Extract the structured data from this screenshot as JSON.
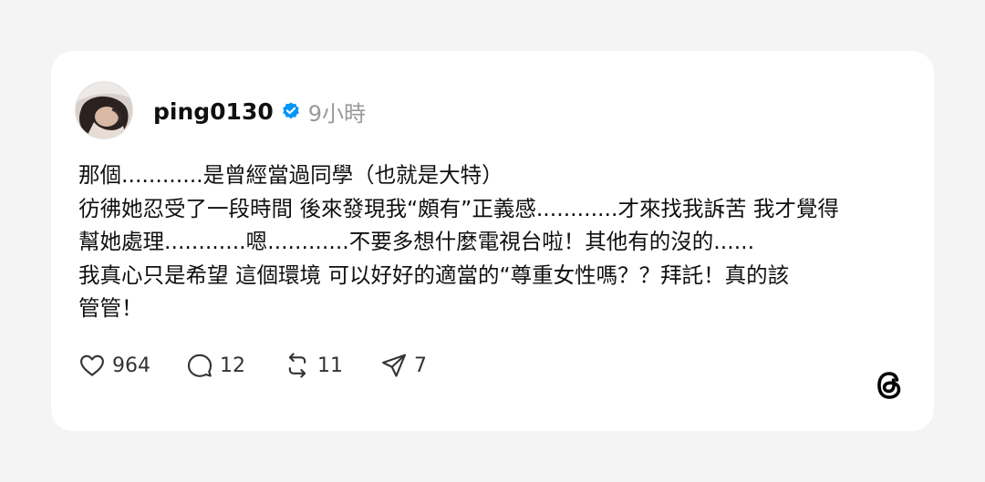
{
  "post": {
    "username": "ping0130",
    "verified": true,
    "time": "9小時",
    "lines": [
      "那個............是曾經當過同學（也就是大特）",
      "彷彿她忍受了一段時間 後來發現我“頗有”正義感............才來找我訴苦 我才覺得",
      "幫她處理............嗯............不要多想什麼電視台啦！其他有的沒的......",
      "我真心只是希望 這個環境 可以好好的適當的“尊重女性嗎？？拜託！真的該",
      "管管！"
    ]
  },
  "actions": {
    "likes": "964",
    "replies": "12",
    "reposts": "11",
    "shares": "7"
  },
  "icons": {
    "verified": "verified-badge-icon",
    "like": "heart-icon",
    "reply": "comment-bubble-icon",
    "repost": "repost-icon",
    "share": "send-icon",
    "brand": "threads-logo-icon"
  },
  "colors": {
    "background": "#f4f4f4",
    "card": "#ffffff",
    "text": "#101010",
    "muted": "#999999",
    "verified": "#0095f6"
  }
}
